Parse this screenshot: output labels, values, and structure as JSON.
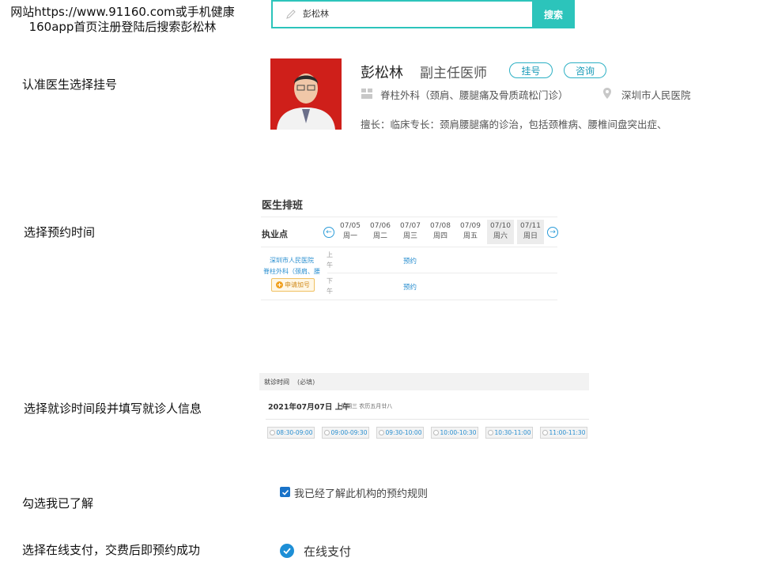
{
  "steps": {
    "intro": "网站https://www.91160.com或手机健康160app首页注册登陆后搜索彭松林",
    "step1": "认准医生选择挂号",
    "step2": "选择预约时间",
    "step3": "选择就诊时间段并填写就诊人信息",
    "step4": "勾选我已了解",
    "step5": "选择在线支付，交费后即预约成功"
  },
  "search": {
    "value": "彭松林",
    "icon": "pencil-icon",
    "button_label": "搜索",
    "accent": "#2cc4bb"
  },
  "doctor": {
    "name": "彭松林",
    "title": "副主任医师",
    "register_label": "挂号",
    "consult_label": "咨询",
    "department": "脊柱外科（颈肩、腰腿痛及骨质疏松门诊）",
    "hospital": "深圳市人民医院",
    "specialty": "擅长：临床专长：颈肩腰腿痛的诊治，包括颈椎病、腰椎间盘突出症、"
  },
  "schedule": {
    "title": "医生排班",
    "practice_label": "执业点",
    "days": [
      {
        "date": "07/05",
        "weekday": "周一",
        "highlight": false
      },
      {
        "date": "07/06",
        "weekday": "周二",
        "highlight": false
      },
      {
        "date": "07/07",
        "weekday": "周三",
        "highlight": false
      },
      {
        "date": "07/08",
        "weekday": "周四",
        "highlight": false
      },
      {
        "date": "07/09",
        "weekday": "周五",
        "highlight": false
      },
      {
        "date": "07/10",
        "weekday": "周六",
        "highlight": true
      },
      {
        "date": "07/11",
        "weekday": "周日",
        "highlight": true
      }
    ],
    "hospital_link": "深圳市人民医院",
    "dept_link": "脊柱外科（颈肩、腰",
    "morning": "上午",
    "afternoon": "下午",
    "book_label": "预约",
    "add_label": "申请加号"
  },
  "visit": {
    "label": "就诊时间",
    "required": "(必填)",
    "date": "2021年07月07日 上午",
    "sub": "星期三 农历五月廿八",
    "slots": [
      "08:30-09:00",
      "09:00-09:30",
      "09:30-10:00",
      "10:00-10:30",
      "10:30-11:00",
      "11:00-11:30"
    ]
  },
  "agree": {
    "text": "我已经了解此机构的预约规则",
    "checked": true
  },
  "payment": {
    "text": "在线支付",
    "selected": true
  }
}
